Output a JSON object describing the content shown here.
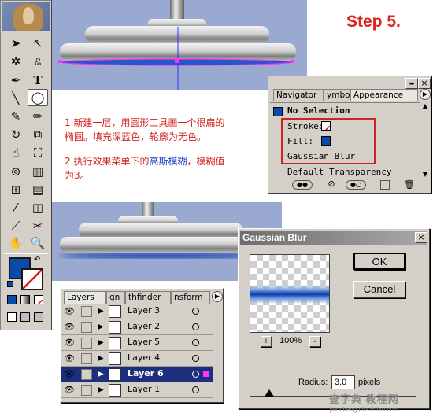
{
  "step_title": "Step 5.",
  "instructions": {
    "line1": "1.新建一层，用圆形工具画一个很扁的",
    "line2": "椭圆。填充深蓝色，轮廓为无色。",
    "line3_pre": "2.执行效果菜单下的",
    "line3_hl": "高斯模糊",
    "line3_post": "，模糊值",
    "line4": "为3。"
  },
  "appearance_panel": {
    "tabs": [
      "Navigator",
      "ymbol",
      "Appearance"
    ],
    "selection": "No Selection",
    "stroke_label": "Stroke:",
    "fill_label": "Fill:",
    "effect": "Gaussian Blur",
    "default_transparency": "Default Transparency",
    "close_glyph": "×",
    "min_glyph": "▬"
  },
  "layers_panel": {
    "tabs": [
      "Layers",
      "gn",
      "thfinder",
      "nsform"
    ],
    "rows": [
      {
        "name": "Layer 3",
        "active": false
      },
      {
        "name": "Layer 2",
        "active": false
      },
      {
        "name": "Layer 5",
        "active": false
      },
      {
        "name": "Layer 4",
        "active": false
      },
      {
        "name": "Layer 6",
        "active": true
      },
      {
        "name": "Layer 1",
        "active": false
      }
    ]
  },
  "gaussian_dialog": {
    "title": "Gaussian Blur",
    "ok": "OK",
    "cancel": "Cancel",
    "zoom": "100%",
    "plus": "+",
    "minus": "-",
    "radius_label": "Radius:",
    "radius_value": "3.0",
    "unit": "pixels",
    "close_glyph": "×",
    "slider_fraction": 0.12
  },
  "colors": {
    "fill": "#0a4aa8",
    "canvas": "#9aa9cf",
    "accent_red": "#d12222",
    "selection_magenta": "#ff33ff"
  },
  "watermark": {
    "line1": "查字典 教程网",
    "line2": "jiaocheng.chazidian.com"
  }
}
